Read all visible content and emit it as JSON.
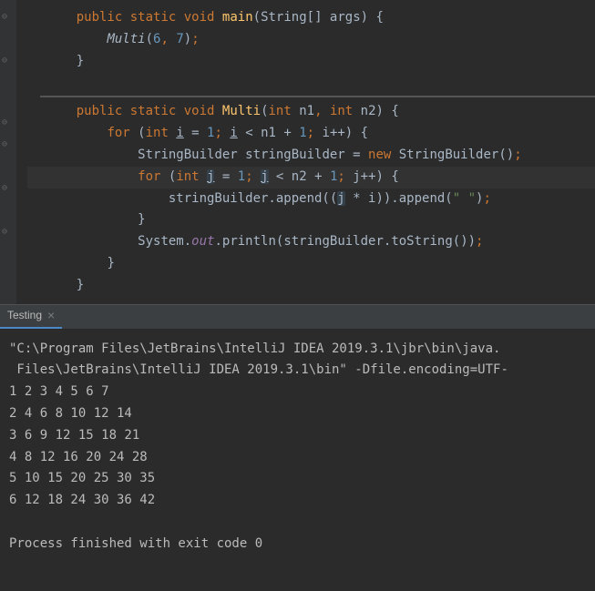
{
  "editor": {
    "lines": [
      {
        "indent": 2,
        "tokens": [
          {
            "t": "public ",
            "c": "kw"
          },
          {
            "t": "static ",
            "c": "kw"
          },
          {
            "t": "void ",
            "c": "kw"
          },
          {
            "t": "main",
            "c": "methoddef"
          },
          {
            "t": "(",
            "c": "paren"
          },
          {
            "t": "String[] args",
            "c": ""
          },
          {
            "t": ") {",
            "c": "paren"
          }
        ]
      },
      {
        "indent": 4,
        "tokens": [
          {
            "t": "Multi",
            "c": "ital"
          },
          {
            "t": "(",
            "c": "paren"
          },
          {
            "t": "6",
            "c": "num"
          },
          {
            "t": ", ",
            "c": "punct"
          },
          {
            "t": "7",
            "c": "num"
          },
          {
            "t": ")",
            "c": "paren"
          },
          {
            "t": ";",
            "c": "punct"
          }
        ]
      },
      {
        "indent": 2,
        "tokens": [
          {
            "t": "}",
            "c": "paren"
          }
        ]
      },
      {
        "indent": 0,
        "tokens": []
      },
      {
        "bar": true
      },
      {
        "indent": 2,
        "tokens": [
          {
            "t": "public ",
            "c": "kw"
          },
          {
            "t": "static ",
            "c": "kw"
          },
          {
            "t": "void ",
            "c": "kw"
          },
          {
            "t": "Multi",
            "c": "methoddef"
          },
          {
            "t": "(",
            "c": "paren"
          },
          {
            "t": "int ",
            "c": "type"
          },
          {
            "t": "n1",
            "c": ""
          },
          {
            "t": ", ",
            "c": "punct"
          },
          {
            "t": "int ",
            "c": "type"
          },
          {
            "t": "n2",
            "c": ""
          },
          {
            "t": ") {",
            "c": "paren"
          }
        ]
      },
      {
        "indent": 4,
        "tokens": [
          {
            "t": "for ",
            "c": "kw"
          },
          {
            "t": "(",
            "c": "paren"
          },
          {
            "t": "int ",
            "c": "type"
          },
          {
            "t": "i",
            "c": "",
            "u": true
          },
          {
            "t": " = ",
            "c": ""
          },
          {
            "t": "1",
            "c": "num"
          },
          {
            "t": "; ",
            "c": "punct"
          },
          {
            "t": "i",
            "c": "",
            "u": true
          },
          {
            "t": " < n1 + ",
            "c": ""
          },
          {
            "t": "1",
            "c": "num"
          },
          {
            "t": "; ",
            "c": "punct"
          },
          {
            "t": "i++) {",
            "c": ""
          }
        ]
      },
      {
        "indent": 6,
        "tokens": [
          {
            "t": "StringBuilder stringBuilder = ",
            "c": ""
          },
          {
            "t": "new ",
            "c": "kw"
          },
          {
            "t": "StringBuilder()",
            "c": ""
          },
          {
            "t": ";",
            "c": "punct"
          }
        ]
      },
      {
        "indent": 6,
        "highlighted": true,
        "tokens": [
          {
            "t": "for ",
            "c": "kw"
          },
          {
            "t": "(",
            "c": "paren"
          },
          {
            "t": "int ",
            "c": "type"
          },
          {
            "t": "j",
            "c": "",
            "u": true,
            "hl": true
          },
          {
            "t": " = ",
            "c": ""
          },
          {
            "t": "1",
            "c": "num"
          },
          {
            "t": "; ",
            "c": "punct"
          },
          {
            "t": "j",
            "c": "",
            "u": true,
            "hl": true
          },
          {
            "t": " < n2 + ",
            "c": ""
          },
          {
            "t": "1",
            "c": "num"
          },
          {
            "t": "; ",
            "c": "punct"
          },
          {
            "t": "j++) {",
            "c": ""
          }
        ]
      },
      {
        "indent": 8,
        "tokens": [
          {
            "t": "stringBuilder.append((",
            "c": ""
          },
          {
            "t": "j",
            "c": "",
            "hl": true
          },
          {
            "t": " * i)).append(",
            "c": ""
          },
          {
            "t": "\" \"",
            "c": "str"
          },
          {
            "t": ")",
            "c": "paren"
          },
          {
            "t": ";",
            "c": "punct"
          }
        ]
      },
      {
        "indent": 6,
        "tokens": [
          {
            "t": "}",
            "c": "paren"
          }
        ]
      },
      {
        "indent": 6,
        "tokens": [
          {
            "t": "System.",
            "c": ""
          },
          {
            "t": "out",
            "c": "field"
          },
          {
            "t": ".println(stringBuilder.toString())",
            "c": ""
          },
          {
            "t": ";",
            "c": "punct"
          }
        ]
      },
      {
        "indent": 4,
        "tokens": [
          {
            "t": "}",
            "c": "paren"
          }
        ]
      },
      {
        "indent": 2,
        "tokens": [
          {
            "t": "}",
            "c": "paren"
          }
        ]
      }
    ]
  },
  "tab": {
    "label": "Testing",
    "close": "×"
  },
  "console": {
    "lines": [
      "\"C:\\Program Files\\JetBrains\\IntelliJ IDEA 2019.3.1\\jbr\\bin\\java.",
      " Files\\JetBrains\\IntelliJ IDEA 2019.3.1\\bin\" -Dfile.encoding=UTF-",
      "1 2 3 4 5 6 7",
      "2 4 6 8 10 12 14",
      "3 6 9 12 15 18 21",
      "4 8 12 16 20 24 28",
      "5 10 15 20 25 30 35",
      "6 12 18 24 30 36 42",
      "",
      "Process finished with exit code 0"
    ]
  }
}
